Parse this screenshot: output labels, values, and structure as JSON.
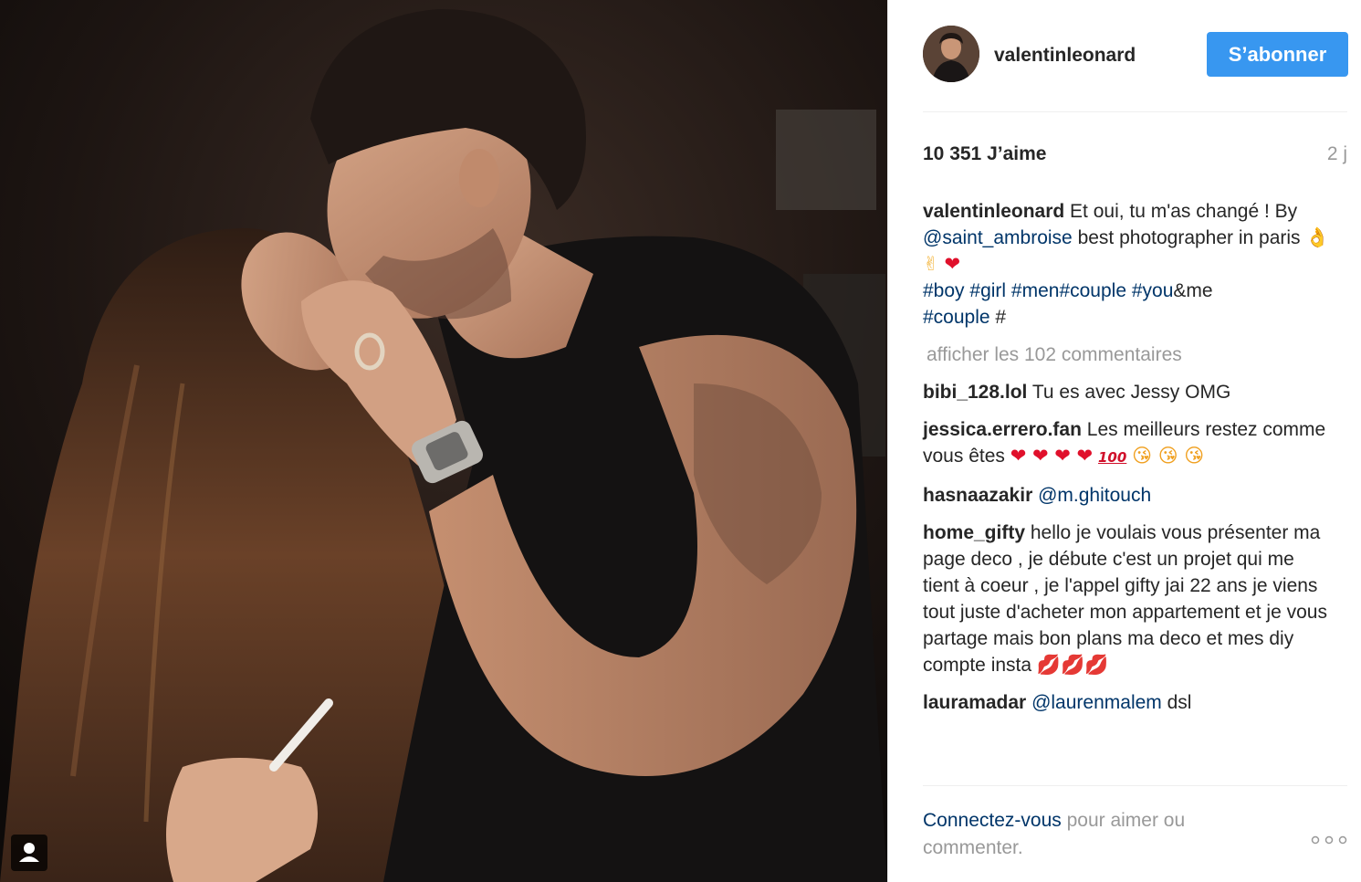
{
  "author": {
    "username": "valentinleonard",
    "follow_label": "S’abonner"
  },
  "stats": {
    "likes": "10 351 J’aime",
    "time": "2 j"
  },
  "caption": {
    "user": "valentinleonard",
    "text1": " Et oui, tu m'as changé ! By ",
    "mention": "@saint_ambroise",
    "text2": " best photographer in paris ",
    "emoji1": "👌✌",
    "emoji2": "❤",
    "hashtags": [
      "#boy",
      "#girl",
      "#men",
      "#couple",
      "#you"
    ],
    "text3": "&me",
    "hashtag_last": "#couple",
    "text4": " #"
  },
  "load_more": "afficher les 102 commentaires",
  "comments": [
    {
      "user": "bibi_128.lol",
      "text": " Tu es avec Jessy OMG"
    },
    {
      "user": "jessica.errero.fan",
      "text": " Les meilleurs restez comme vous êtes ",
      "hearts": "❤ ❤ ❤ ❤",
      "hundred": "100",
      "kisses": "😘 😘 😘"
    },
    {
      "user": "hasnaazakir",
      "mention": "@m.ghitouch"
    },
    {
      "user": "home_gifty",
      "text": " hello je voulais vous présenter ma page deco , je débute c'est un projet qui me tient à coeur , je l'appel gifty jai 22 ans je viens tout juste d'acheter mon appartement et je vous partage mais bon plans ma deco et mes diy compte insta ",
      "lips": "💋💋💋"
    },
    {
      "user": "lauramadar",
      "mention": "@laurenmalem",
      "text": " dsl"
    }
  ],
  "footer": {
    "login_link": "Connectez-vous",
    "rest": " pour aimer ou commenter."
  },
  "icons": {
    "tag": "user-tag-icon",
    "more": "more-options-icon"
  },
  "colors": {
    "accent": "#3897f0",
    "link": "#003569",
    "muted": "#999999"
  }
}
